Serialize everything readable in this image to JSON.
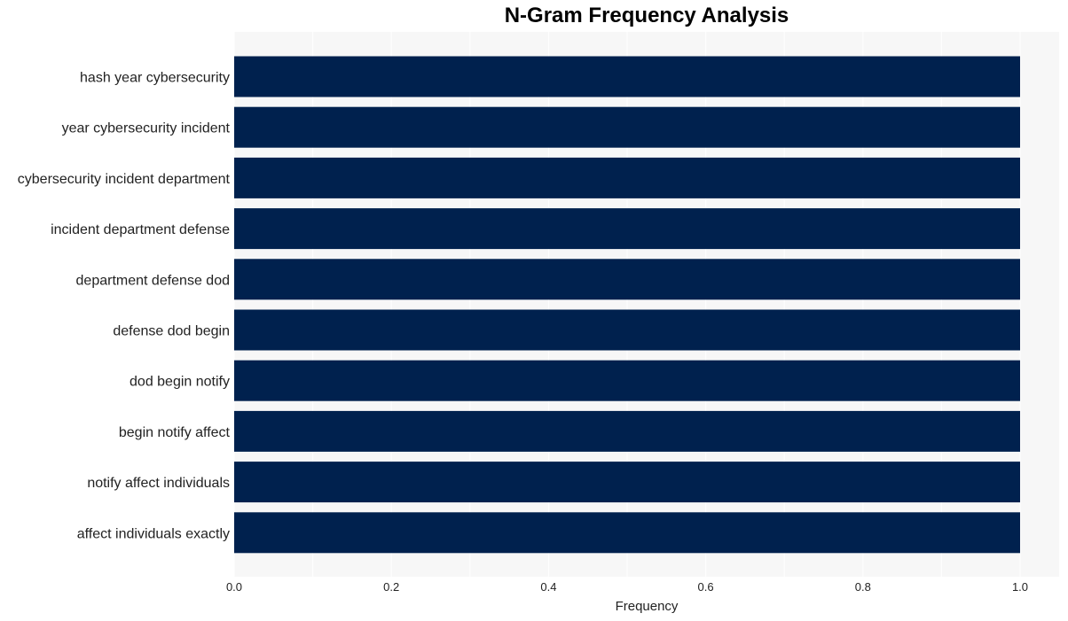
{
  "chart_data": {
    "type": "bar",
    "orientation": "horizontal",
    "title": "N-Gram Frequency Analysis",
    "xlabel": "Frequency",
    "ylabel": "",
    "categories": [
      "hash year cybersecurity",
      "year cybersecurity incident",
      "cybersecurity incident department",
      "incident department defense",
      "department defense dod",
      "defense dod begin",
      "dod begin notify",
      "begin notify affect",
      "notify affect individuals",
      "affect individuals exactly"
    ],
    "values": [
      1,
      1,
      1,
      1,
      1,
      1,
      1,
      1,
      1,
      1
    ],
    "xlim": [
      0,
      1.05
    ],
    "xticks": [
      0.0,
      0.2,
      0.4,
      0.6,
      0.8,
      1.0
    ],
    "xtick_labels": [
      "0.0",
      "0.2",
      "0.4",
      "0.6",
      "0.8",
      "1.0"
    ],
    "grid": true,
    "legend": "none",
    "colors": {
      "bar": "#00214e",
      "plot_background": "#f7f7f7",
      "grid": "#ffffff"
    }
  }
}
